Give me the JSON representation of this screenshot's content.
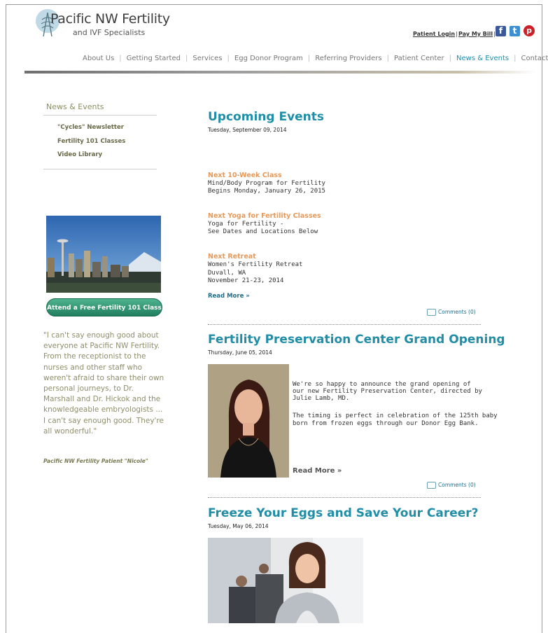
{
  "header": {
    "logo_title": "Pacific NW Fertility",
    "logo_sub": "and IVF Specialists",
    "patient_login": "Patient Login",
    "pay_bill": "Pay My Bill",
    "sep": "|"
  },
  "nav": {
    "items": [
      "About Us",
      "Getting Started",
      "Services",
      "Egg Donor Program",
      "Referring Providers",
      "Patient Center",
      "News & Events",
      "Contact"
    ],
    "active": "News & Events"
  },
  "sidebar": {
    "heading": "News & Events",
    "links": [
      "\"Cycles\" Newsletter",
      "Fertility 101 Classes",
      "Video Library"
    ],
    "cta": "Attend a Free Fertility 101 Class",
    "quote": "\"I can't say enough good about everyone at Pacific NW Fertility. From the receptionist to the nurses and other staff who weren't afraid to share their own personal journeys, to Dr. Marshall and Dr. Hickok and the knowledgeable embryologists ... I can't say enough good. They're all wonderful.\"",
    "quote_by": "Pacific NW Fertility Patient \"Nicole\""
  },
  "posts": {
    "p1": {
      "title": "Upcoming Events",
      "date": "Tuesday, September 09, 2014",
      "e1_title": "Next 10-Week Class",
      "e1_l1": "Mind/Body Program for Fertility",
      "e1_l2": "Begins Monday, January 26, 2015",
      "e2_title": "Next Yoga for Fertility Classes",
      "e2_l1": "Yoga for Fertility -",
      "e2_l2": "See Dates and Locations Below",
      "e3_title": "Next Retreat",
      "e3_l1": "Women's Fertility Retreat",
      "e3_l2": "Duvall, WA",
      "e3_l3": "November 21-23, 2014",
      "read_more": "Read More »",
      "comments": "Comments (0)"
    },
    "p2": {
      "title": "Fertility Preservation Center Grand Opening",
      "date": "Thursday, June 05, 2014",
      "b1": "We're so happy to announce the grand opening of",
      "b2": "our new Fertility Preservation Center, directed by",
      "b3": "Julie Lamb, MD.",
      "b4": "The timing is perfect in celebration of the 125th baby",
      "b5": "born from frozen eggs through our Donor Egg Bank.",
      "read_more": "Read More »",
      "comments": "Comments (0)"
    },
    "p3": {
      "title": "Freeze Your Eggs and Save Your Career?",
      "date": "Tuesday, May 06, 2014"
    }
  },
  "icons": {
    "facebook": "f",
    "twitter": "t",
    "pinterest": "p"
  }
}
